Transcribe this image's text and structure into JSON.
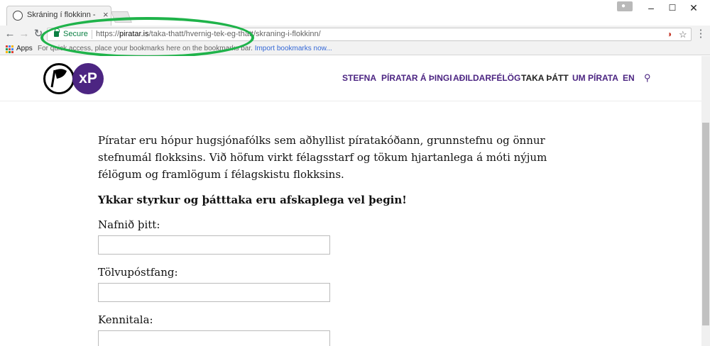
{
  "browser": {
    "tab_title": "Skráning í flokkinn - Píratar",
    "tab_close": "×",
    "window_controls": {
      "minimize": "–",
      "maximize": "☐",
      "close": "✕"
    },
    "nav": {
      "back": "←",
      "forward": "→",
      "reload": "↻"
    },
    "secure_label": "Secure",
    "url_scheme": "https://",
    "url_host": "piratar.is",
    "url_path": "/taka-thatt/hvernig-tek-eg-thatt/skraning-i-flokkinn/",
    "bookmark_star": "☆",
    "menu": "⋮",
    "extension_icon": "◑",
    "profile_icon": "●",
    "bookmarks_bar": {
      "apps_label": "Apps",
      "hint_text": "For quick access, place your bookmarks here on the bookmarks bar.",
      "import_link": "Import bookmarks now..."
    },
    "highlight_color": "#1fb34a"
  },
  "site": {
    "logo_xp": "xP",
    "nav_items": [
      {
        "label": "STEFNA"
      },
      {
        "label": "PÍRATAR Á ÞINGI"
      },
      {
        "label": "AÐILDARFÉLÖG"
      },
      {
        "label": "TAKA ÞÁTT"
      },
      {
        "label": "UM PÍRATA"
      },
      {
        "label": "EN"
      }
    ],
    "search_icon": "⚲",
    "brand_color": "#4c2582"
  },
  "content": {
    "intro": "Píratar eru hópur hugsjónafólks sem aðhyllist píratakóðann, grunnstefnu og önnur stefnumál flokksins. Við höfum virkt félagsstarf og tökum hjartanlega á móti nýjum félögum og framlögum í félagskistu flokksins.",
    "bold_line": "Ykkar styrkur og þátttaka eru afskaplega vel þegin!",
    "fields": [
      {
        "label": "Nafnið þitt:",
        "value": ""
      },
      {
        "label": "Tölvupóstfang:",
        "value": ""
      },
      {
        "label": "Kennitala:",
        "value": ""
      }
    ]
  }
}
